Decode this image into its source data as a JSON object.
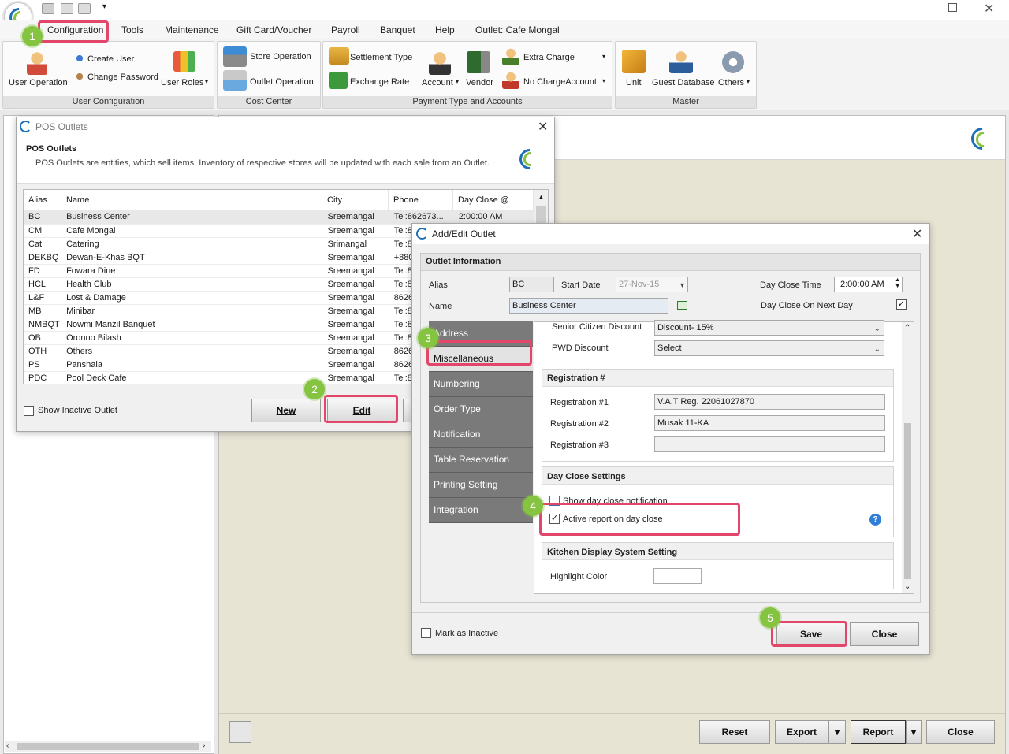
{
  "menu": {
    "items": [
      "Configuration",
      "Tools",
      "Maintenance",
      "Gift Card/Voucher",
      "Payroll",
      "Banquet",
      "Help",
      "Outlet: Cafe Mongal"
    ]
  },
  "ribbon": {
    "user_config": {
      "title": "User Configuration",
      "user_operation": "User Operation",
      "create_user": "Create User",
      "change_password": "Change Password",
      "user_roles": "User Roles"
    },
    "cost_center": {
      "title": "Cost Center",
      "store_operation": "Store Operation",
      "outlet_operation": "Outlet Operation"
    },
    "payment": {
      "title": "Payment Type and Accounts",
      "settlement_type": "Settlement Type",
      "exchange_rate": "Exchange Rate",
      "account": "Account",
      "vendor": "Vendor",
      "extra_charge": "Extra Charge",
      "no_charge_account": "No ChargeAccount"
    },
    "master": {
      "title": "Master",
      "unit": "Unit",
      "guest_database": "Guest Database",
      "others": "Others"
    }
  },
  "pos_outlets": {
    "window_title": "POS Outlets",
    "heading": "POS Outlets",
    "description": "POS Outlets are entities, which sell items. Inventory of respective stores will be updated with each sale from an Outlet.",
    "columns": [
      "Alias",
      "Name",
      "City",
      "Phone",
      "Day Close @"
    ],
    "rows": [
      {
        "alias": "BC",
        "name": "Business Center",
        "city": "Sreemangal",
        "phone": "Tel:862673...",
        "close": "2:00:00 AM"
      },
      {
        "alias": "CM",
        "name": "Cafe Mongal",
        "city": "Sreemangal",
        "phone": "Tel:8",
        "close": ""
      },
      {
        "alias": "Cat",
        "name": "Catering",
        "city": "Srimangal",
        "phone": "Tel:8",
        "close": ""
      },
      {
        "alias": "DEKBQ",
        "name": "Dewan-E-Khas BQT",
        "city": "Sreemangal",
        "phone": "+880",
        "close": ""
      },
      {
        "alias": "FD",
        "name": "Fowara Dine",
        "city": "Sreemangal",
        "phone": "Tel:8",
        "close": ""
      },
      {
        "alias": "HCL",
        "name": "Health Club",
        "city": "Sreemangal",
        "phone": "Tel:8",
        "close": ""
      },
      {
        "alias": "L&F",
        "name": "Lost & Damage",
        "city": "Sreemangal",
        "phone": "8626",
        "close": ""
      },
      {
        "alias": "MB",
        "name": "Minibar",
        "city": "Sreemangal",
        "phone": "Tel:8",
        "close": ""
      },
      {
        "alias": "NMBQT",
        "name": "Nowmi Manzil Banquet",
        "city": "Sreemangal",
        "phone": "Tel:8",
        "close": ""
      },
      {
        "alias": "OB",
        "name": "Oronno Bilash",
        "city": "Sreemangal",
        "phone": "Tel:8",
        "close": ""
      },
      {
        "alias": "OTH",
        "name": "Others",
        "city": "Sreemangal",
        "phone": "8626",
        "close": ""
      },
      {
        "alias": "PS",
        "name": "Panshala",
        "city": "Sreemangal",
        "phone": "8626",
        "close": ""
      },
      {
        "alias": "PDC",
        "name": "Pool Deck Cafe",
        "city": "Sreemangal",
        "phone": "Tel:8",
        "close": ""
      }
    ],
    "show_inactive": "Show Inactive Outlet",
    "new_label": "New",
    "edit_label": "Edit"
  },
  "edit_outlet": {
    "window_title": "Add/Edit Outlet",
    "section": "Outlet Information",
    "alias_label": "Alias",
    "alias_value": "BC",
    "start_date_label": "Start Date",
    "start_date_value": "27-Nov-15",
    "day_close_time_label": "Day Close Time",
    "day_close_time_value": "2:00:00 AM",
    "name_label": "Name",
    "name_value": "Business Center",
    "day_close_next_day_label": "Day Close On Next Day",
    "tabs": [
      "Address",
      "Miscellaneous",
      "Numbering",
      "Order Type",
      "Notification",
      "Table Reservation",
      "Printing Setting",
      "Integration"
    ],
    "senior_label": "Senior Citizen Discount",
    "senior_value": "Discount- 15%",
    "pwd_label": "PWD Discount",
    "pwd_value": "Select",
    "registration_title": "Registration #",
    "reg1_label": "Registration #1",
    "reg1_value": "V.A.T Reg. 22061027870",
    "reg2_label": "Registration #2",
    "reg2_value": "Musak 11-KA",
    "reg3_label": "Registration #3",
    "reg3_value": "",
    "day_close_title": "Day Close Settings",
    "show_notification": "Show day close notification",
    "active_report": "Active report on day close",
    "kds_title": "Kitchen Display System Setting",
    "highlight_label": "Highlight Color",
    "mark_inactive": "Mark as Inactive",
    "save_label": "Save",
    "close_label": "Close"
  },
  "bottom_bar": {
    "reset": "Reset",
    "export": "Export",
    "report": "Report",
    "close": "Close"
  },
  "badges": [
    "1",
    "2",
    "3",
    "4",
    "5"
  ],
  "colors": {
    "highlight": "#e2466b",
    "badge": "#85c440",
    "tab_bg": "#7a7a7a"
  }
}
